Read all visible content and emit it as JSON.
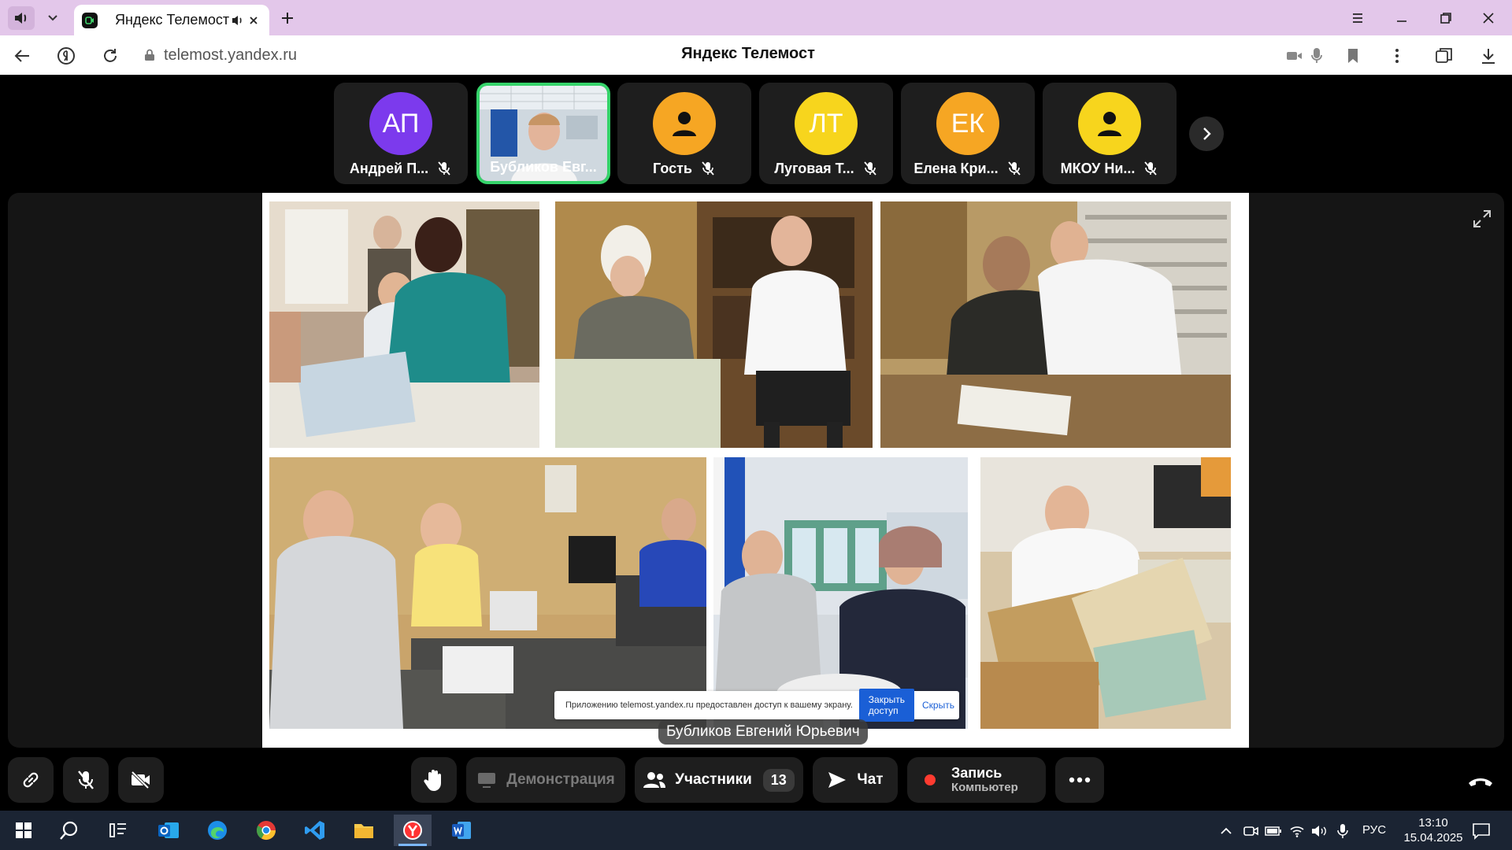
{
  "browser": {
    "tab_title": "Яндекс Телемост",
    "url": "telemost.yandex.ru",
    "page_title": "Яндекс Телемост",
    "tab_bg_color": "#e3c7ea"
  },
  "participants": [
    {
      "initials": "АП",
      "name": "Андрей П...",
      "color": "#7c3aed",
      "muted": true
    },
    {
      "initials": "",
      "name": "Бубликов Евг...",
      "color": "#35d36a",
      "muted": false,
      "video": true,
      "active": true
    },
    {
      "initials": "",
      "name": "Гость",
      "color": "#f6a623",
      "muted": true
    },
    {
      "initials": "ЛТ",
      "name": "Луговая Т...",
      "color": "#f7d51d",
      "muted": true
    },
    {
      "initials": "ЕК",
      "name": "Елена Кри...",
      "color": "#f6a623",
      "muted": true
    },
    {
      "initials": "",
      "name": "МКОУ Ни...",
      "color": "#f7d51d",
      "muted": true
    }
  ],
  "share_notice": {
    "text": "Приложению telemost.yandex.ru предоставлен доступ к вашему экрану.",
    "stop_label": "Закрыть доступ",
    "hide_label": "Скрыть"
  },
  "speaker_label": "Бубликов Евгений Юрьевич",
  "controls": {
    "demo_label": "Демонстрация",
    "participants_label": "Участники",
    "participants_count": "13",
    "chat_label": "Чат",
    "record_title": "Запись",
    "record_sub": "Компьютер"
  },
  "taskbar": {
    "lang": "РУС",
    "time": "13:10",
    "date": "15.04.2025"
  }
}
